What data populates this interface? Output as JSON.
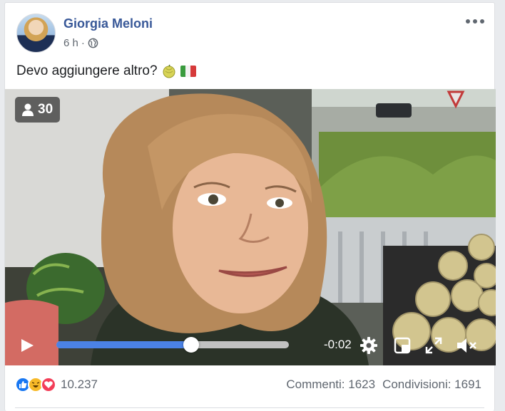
{
  "post": {
    "author": "Giorgia Meloni",
    "time": "6 h",
    "separator": "·",
    "text": "Devo aggiungere altro?",
    "privacy_icon": "globe-icon",
    "emoji": [
      "melon-icon",
      "italy-flag-icon"
    ]
  },
  "video": {
    "viewers": "30",
    "time_remaining": "-0:02",
    "progress": 0.58,
    "controls": [
      "play-icon",
      "settings-gear-icon",
      "miniplayer-icon",
      "fullscreen-icon",
      "mute-icon"
    ]
  },
  "footer": {
    "reaction_count": "10.237",
    "reactions": [
      "like",
      "haha",
      "love"
    ],
    "comments": "Commenti: 1623",
    "shares": "Condivisioni: 1691"
  },
  "colors": {
    "author": "#385898",
    "progress": "#4b82e6",
    "like": "#1877f2",
    "haha": "#f7b928",
    "love": "#f33e58"
  }
}
